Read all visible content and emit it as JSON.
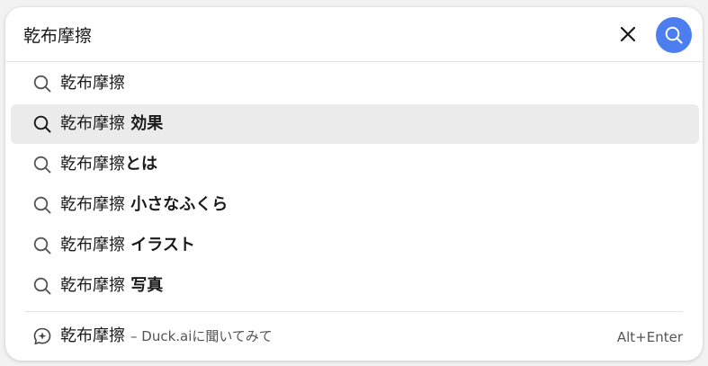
{
  "search": {
    "value": "乾布摩擦",
    "clear_icon": "close-icon",
    "submit_icon": "search-icon"
  },
  "colors": {
    "accent": "#4c7ef0",
    "active_row": "#ebebeb"
  },
  "suggestions": [
    {
      "base": "乾布摩擦",
      "suffix": "",
      "active": false
    },
    {
      "base": "乾布摩擦",
      "suffix": " 効果",
      "active": true
    },
    {
      "base": "乾布摩擦",
      "suffix": "とは",
      "active": false
    },
    {
      "base": "乾布摩擦",
      "suffix": " 小さなふくら",
      "active": false
    },
    {
      "base": "乾布摩擦",
      "suffix": " イラスト",
      "active": false
    },
    {
      "base": "乾布摩擦",
      "suffix": " 写真",
      "active": false
    }
  ],
  "ai": {
    "query": "乾布摩擦",
    "label": "– Duck.aiに聞いてみて",
    "shortcut": "Alt+Enter",
    "icon": "duck-ai-chat-icon"
  }
}
